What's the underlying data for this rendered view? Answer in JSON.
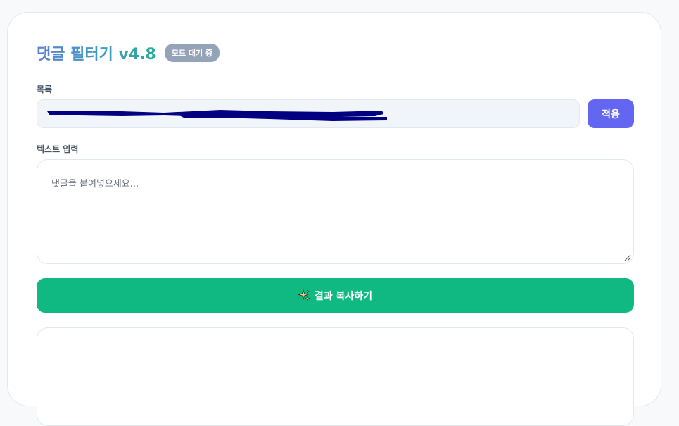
{
  "header": {
    "title": "댓글 필터기 v4.8",
    "status_badge": "모드 대기 중"
  },
  "list_section": {
    "label": "목록",
    "value_redacted": true,
    "apply_label": "적용"
  },
  "text_section": {
    "label": "텍스트 입력",
    "placeholder": "댓글을 붙여넣으세요..."
  },
  "copy_button": {
    "icon": "sparkles-icon",
    "label": "결과 복사하기"
  },
  "colors": {
    "accent": "#6366f1",
    "success": "#10b981",
    "badge": "#94a3b8",
    "redaction": "#000080"
  }
}
